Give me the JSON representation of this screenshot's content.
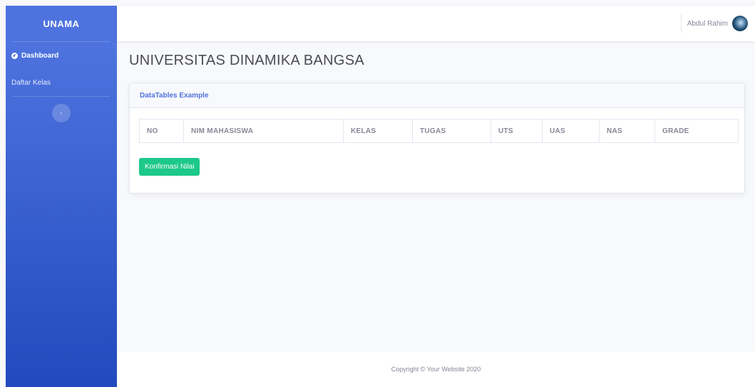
{
  "sidebar": {
    "brand": "UNAMA",
    "items": [
      {
        "label": "Dashboard",
        "active": true
      },
      {
        "label": "Daftar Kelas",
        "active": false
      }
    ],
    "toggle_icon": "‹"
  },
  "topbar": {
    "user_name": "Abdul Rahim"
  },
  "page": {
    "title": "UNIVERSITAS DINAMIKA BANGSA"
  },
  "card": {
    "title": "DataTables Example",
    "columns": [
      "NO",
      "NIM MAHASISWA",
      "KELAS",
      "TUGAS",
      "UTS",
      "UAS",
      "NAS",
      "GRADE"
    ],
    "rows": [],
    "button_label": "Konfirmasi Nilai"
  },
  "footer": {
    "text": "Copyright © Your Website 2020"
  },
  "colors": {
    "primary": "#4e73df",
    "success": "#1cc88a",
    "sidebar_dark": "#224abe"
  }
}
